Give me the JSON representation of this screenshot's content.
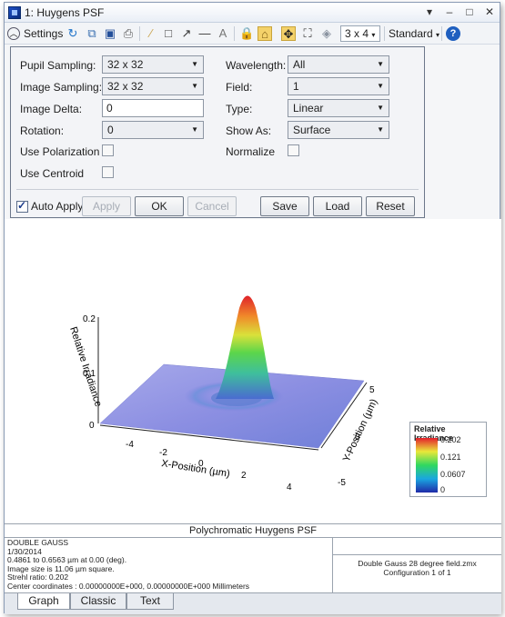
{
  "window": {
    "title": "1: Huygens PSF",
    "minimize": "–",
    "maximize": "□",
    "close": "✕",
    "pin": "▾"
  },
  "toolbar": {
    "settings_label": "Settings",
    "layout_value": "3 x 4",
    "style_value": "Standard",
    "text_glyph": "A"
  },
  "settings": {
    "pupil_sampling": {
      "label": "Pupil Sampling:",
      "value": "32 x 32"
    },
    "image_sampling": {
      "label": "Image Sampling:",
      "value": "32 x 32"
    },
    "image_delta": {
      "label": "Image Delta:",
      "value": "0"
    },
    "rotation": {
      "label": "Rotation:",
      "value": "0"
    },
    "use_polarization": {
      "label": "Use Polarization",
      "checked": false
    },
    "use_centroid": {
      "label": "Use Centroid",
      "checked": false
    },
    "wavelength": {
      "label": "Wavelength:",
      "value": "All"
    },
    "field": {
      "label": "Field:",
      "value": "1"
    },
    "type": {
      "label": "Type:",
      "value": "Linear"
    },
    "show_as": {
      "label": "Show As:",
      "value": "Surface"
    },
    "normalize": {
      "label": "Normalize",
      "checked": false
    },
    "auto_apply": {
      "label": "Auto Apply",
      "checked": true
    },
    "buttons": {
      "apply": "Apply",
      "ok": "OK",
      "cancel": "Cancel",
      "save": "Save",
      "load": "Load",
      "reset": "Reset"
    }
  },
  "plot": {
    "z_axis_label": "Relative Irradiance",
    "z_ticks": [
      "0",
      "0.1",
      "0.2"
    ],
    "x_axis_label": "X-Position (µm)",
    "x_ticks": [
      "-4",
      "-2",
      "0",
      "2",
      "4"
    ],
    "y_axis_label": "Y-Position (µm)",
    "y_ticks": [
      "5",
      "0",
      "-5"
    ],
    "legend_title": "Relative Irradiance",
    "legend_ticks": [
      "0.202",
      "0.121",
      "0.0607",
      "0"
    ],
    "colors": {
      "low": "#2233aa",
      "mid": "#39d76a",
      "high": "#e8202a",
      "base": "#8f96e0"
    }
  },
  "info": {
    "title": "Polychromatic Huygens PSF",
    "lines": [
      "DOUBLE GAUSS",
      "1/30/2014",
      "0.4861 to 0.6563 µm at 0.00 (deg).",
      "Image size is 11.06 µm square.",
      "Strehl ratio: 0.202",
      "Center coordinates  :  0.00000000E+000,  0.00000000E+000 Millimeters"
    ],
    "file": "Double Gauss 28 degree field.zmx",
    "config": "Configuration 1 of 1"
  },
  "tabs": [
    "Graph",
    "Classic",
    "Text"
  ]
}
